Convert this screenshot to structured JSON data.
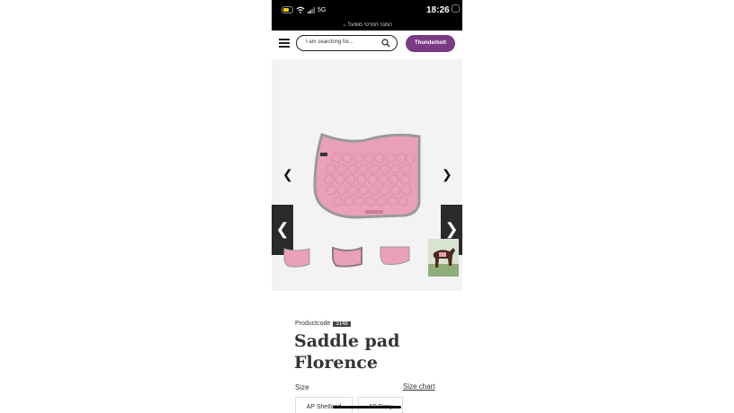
{
  "status_bar": {
    "time": "18:26",
    "subtitle": "המנוי הפרטי מופעל",
    "network": "5G"
  },
  "header": {
    "search_placeholder": "I am searching for...",
    "account_button": "Thunderbolt"
  },
  "gallery": {
    "prev_icon": "chevron-left-icon",
    "next_icon": "chevron-right-icon",
    "main_image_color": "#e9a0b8",
    "thumbnails": [
      "saddle-pad-thumb-1",
      "saddle-pad-thumb-2",
      "saddle-pad-thumb-3",
      "horse-thumb"
    ]
  },
  "product": {
    "code_label": "Productcode",
    "code_value": "3148",
    "title": "Saddle pad Florence",
    "size_label": "Size",
    "size_chart_link": "Size chart",
    "sizes": [
      "AP Shetland",
      "AP Pony"
    ]
  },
  "colors": {
    "accent": "#7b3a86",
    "pad_pink": "#e9a0b8",
    "piping_grey": "#9a9a9a"
  }
}
